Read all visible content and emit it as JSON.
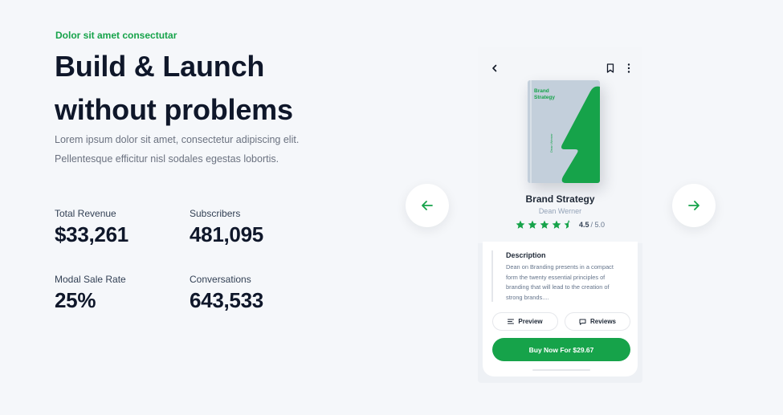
{
  "hero": {
    "eyebrow": "Dolor sit amet consectutar",
    "headline_line1": "Build & Launch",
    "headline_line2": "without problems",
    "description_line1": "Lorem ipsum dolor sit amet, consectetur adipiscing elit.",
    "description_line2": "Pellentesque efficitur nisl sodales egestas lobortis."
  },
  "stats": [
    {
      "label": "Total Revenue",
      "value": "$33,261"
    },
    {
      "label": "Subscribers",
      "value": "481,095"
    },
    {
      "label": "Modal Sale Rate",
      "value": "25%"
    },
    {
      "label": "Conversations",
      "value": "643,533"
    }
  ],
  "carousel": {
    "prev_icon": "arrow-left-icon",
    "next_icon": "arrow-right-icon"
  },
  "phone": {
    "back_icon": "chevron-left-icon",
    "bookmark_icon": "bookmark-icon",
    "more_icon": "more-vertical-icon",
    "book": {
      "cover_title_line1": "Brand",
      "cover_title_line2": "Strategy",
      "cover_author": "Dean Werner",
      "name": "Brand Strategy",
      "author": "Dean Werner",
      "rating": "4.5",
      "rating_max": "/ 5.0",
      "stars": 4.5
    },
    "description": {
      "title": "Description",
      "text": "Dean on Branding presents in a compact form the twenty essential principles of branding that will lead to the creation of strong brands...."
    },
    "preview_label": "Preview",
    "reviews_label": "Reviews",
    "buy_label": "Buy Now For $29.67"
  },
  "colors": {
    "accent": "#16a34a",
    "heading": "#0f172a",
    "muted": "#6b7280",
    "background": "#f5f7fa",
    "book_cover": "#c3cfdb"
  }
}
